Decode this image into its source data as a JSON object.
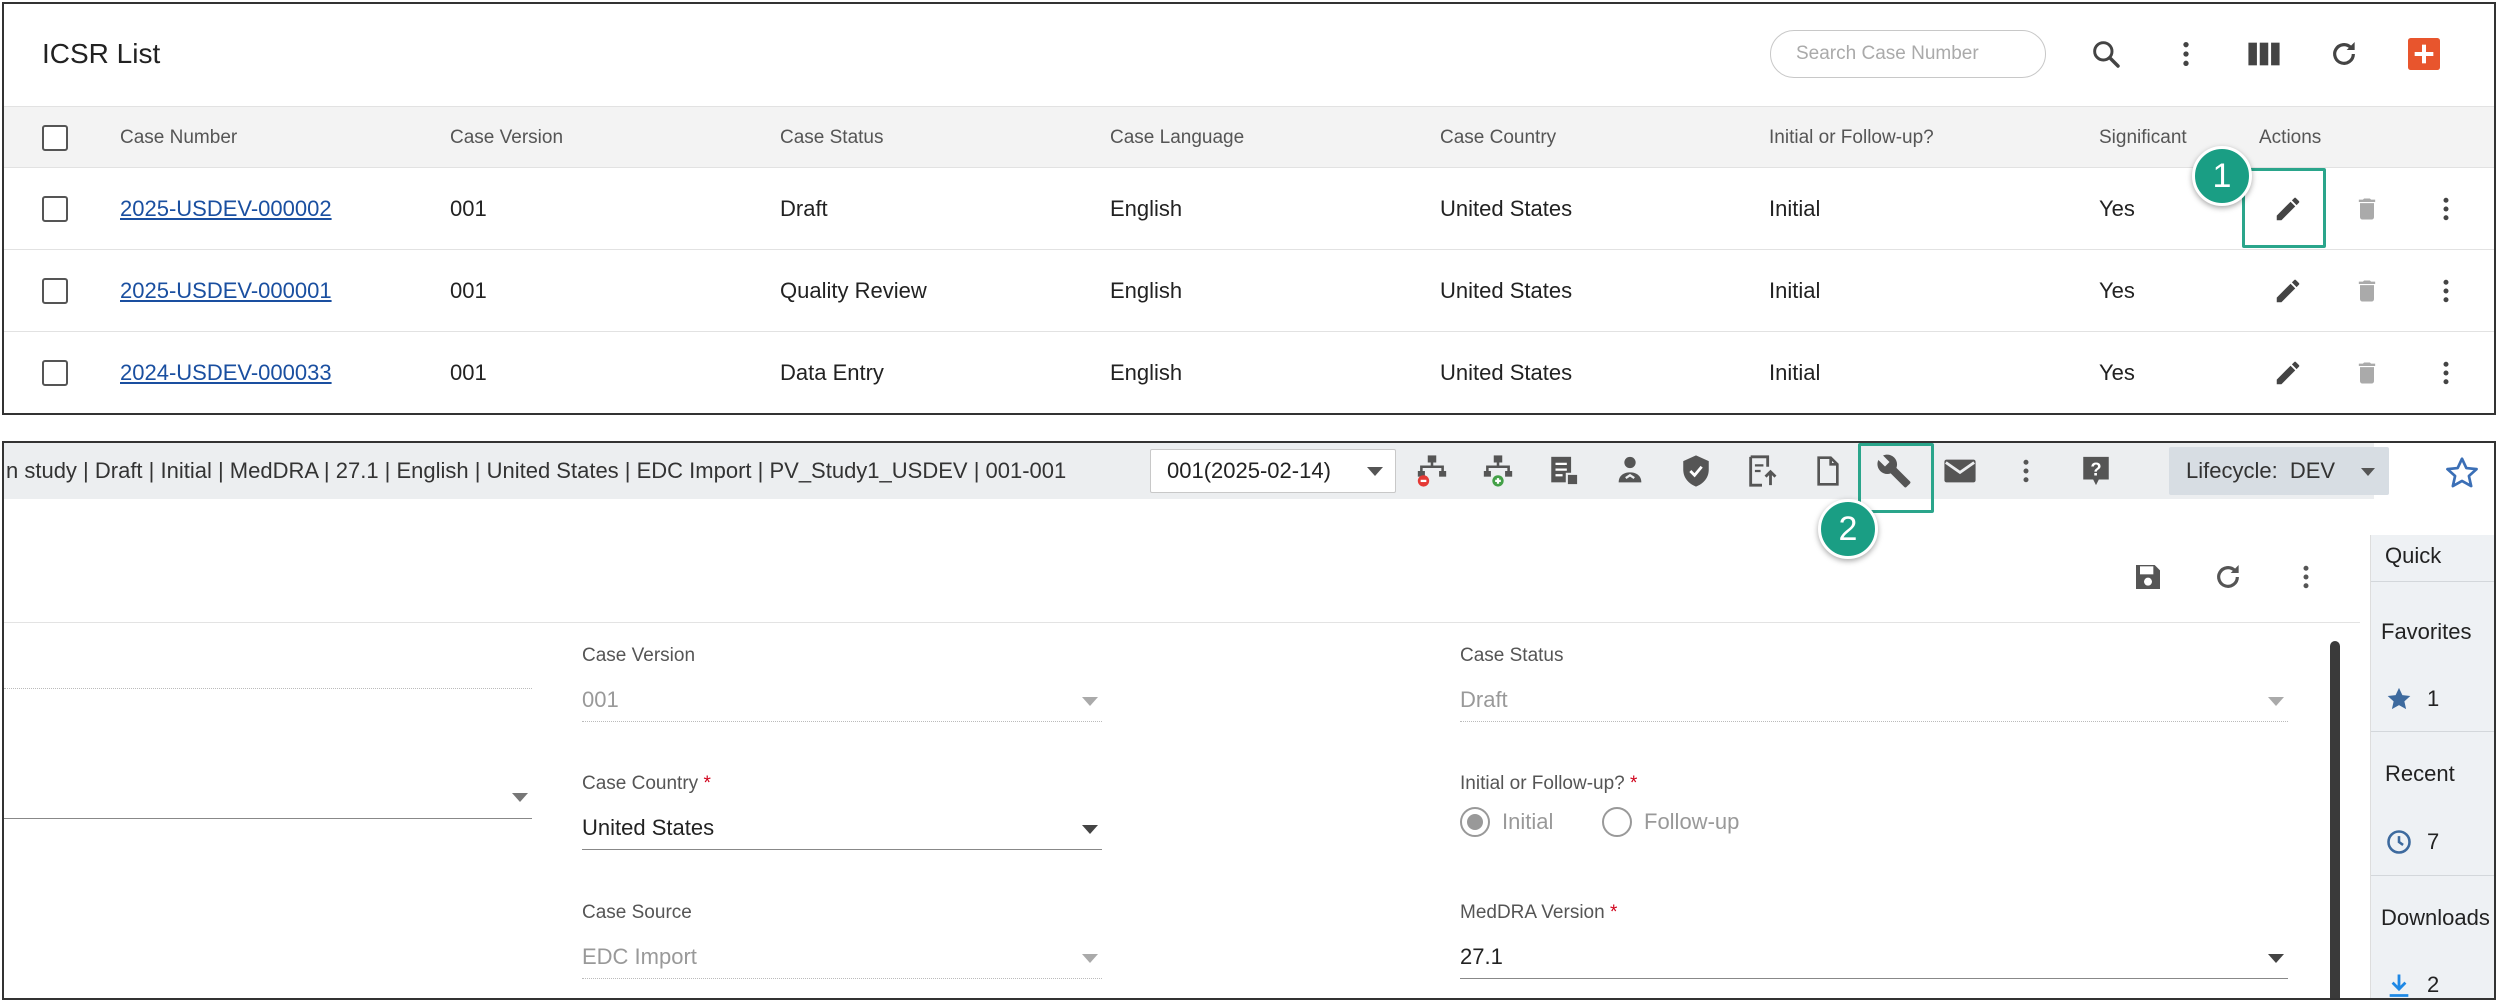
{
  "list": {
    "title": "ICSR List",
    "search_placeholder": "Search Case Number",
    "columns": [
      "Case Number",
      "Case Version",
      "Case Status",
      "Case Language",
      "Case Country",
      "Initial or Follow-up?",
      "Significant",
      "Actions"
    ],
    "rows": [
      {
        "case_number": "2025-USDEV-000002",
        "version": "001",
        "status": "Draft",
        "language": "English",
        "country": "United States",
        "initial": "Initial",
        "significant": "Yes"
      },
      {
        "case_number": "2025-USDEV-000001",
        "version": "001",
        "status": "Quality Review",
        "language": "English",
        "country": "United States",
        "initial": "Initial",
        "significant": "Yes"
      },
      {
        "case_number": "2024-USDEV-000033",
        "version": "001",
        "status": "Data Entry",
        "language": "English",
        "country": "United States",
        "initial": "Initial",
        "significant": "Yes"
      }
    ],
    "callout": "1"
  },
  "case": {
    "info": "n study | Draft | Initial | MedDRA | 27.1 | English | United States | EDC Import | PV_Study1_USDEV | 001-001",
    "version_select": "001(2025-02-14)",
    "lifecycle_label": "Lifecycle:",
    "lifecycle_value": "DEV",
    "callout": "2",
    "fields": {
      "case_version": {
        "label": "Case Version",
        "value": "001"
      },
      "case_status": {
        "label": "Case Status",
        "value": "Draft"
      },
      "case_country": {
        "label": "Case Country",
        "value": "United States"
      },
      "initial_followup": {
        "label": "Initial or Follow-up?",
        "options": [
          "Initial",
          "Follow-up"
        ],
        "selected": "Initial"
      },
      "case_source": {
        "label": "Case Source",
        "value": "EDC Import"
      },
      "meddra_version": {
        "label": "MedDRA Version",
        "value": "27.1"
      },
      "required_mark": "*"
    },
    "sidebar": {
      "quick": "Quick",
      "favorites": "Favorites",
      "favorites_count": "1",
      "recent": "Recent",
      "recent_count": "7",
      "downloads": "Downloads",
      "downloads_count": "2"
    }
  },
  "colors": {
    "accent": "#e8552d",
    "link": "#1a4fa0",
    "callout": "#1a9e84",
    "highlight": "#2aa58b"
  }
}
